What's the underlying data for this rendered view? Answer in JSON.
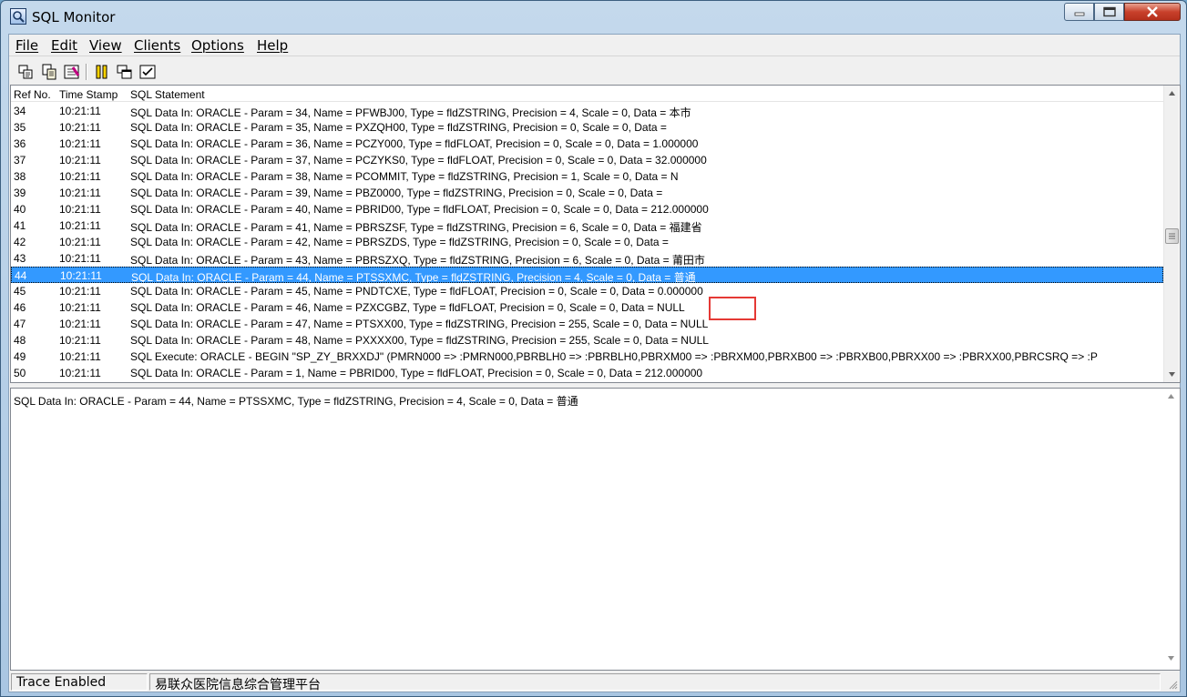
{
  "window": {
    "title": "SQL Monitor"
  },
  "menu": [
    "File",
    "Edit",
    "View",
    "Clients",
    "Options",
    "Help"
  ],
  "toolbar": {
    "buttons": [
      "save-log-icon",
      "copy-icon",
      "clear-icon",
      "pause-icon",
      "client-window-icon",
      "checklist-icon"
    ]
  },
  "columns": {
    "ref": "Ref No.",
    "time": "Time Stamp",
    "stmt": "SQL Statement"
  },
  "rows": [
    {
      "ref": "34",
      "time": "10:21:11",
      "stmt": "SQL Data In: ORACLE - Param = 34, Name = PFWBJ00, Type = fldZSTRING, Precision = 4, Scale = 0, Data = 本市"
    },
    {
      "ref": "35",
      "time": "10:21:11",
      "stmt": "SQL Data In: ORACLE - Param = 35, Name = PXZQH00, Type = fldZSTRING, Precision = 0, Scale = 0, Data ="
    },
    {
      "ref": "36",
      "time": "10:21:11",
      "stmt": "SQL Data In: ORACLE - Param = 36, Name = PCZY000, Type = fldFLOAT, Precision = 0, Scale = 0, Data = 1.000000"
    },
    {
      "ref": "37",
      "time": "10:21:11",
      "stmt": "SQL Data In: ORACLE - Param = 37, Name = PCZYKS0, Type = fldFLOAT, Precision = 0, Scale = 0, Data = 32.000000"
    },
    {
      "ref": "38",
      "time": "10:21:11",
      "stmt": "SQL Data In: ORACLE - Param = 38, Name = PCOMMIT, Type = fldZSTRING, Precision = 1, Scale = 0, Data = N"
    },
    {
      "ref": "39",
      "time": "10:21:11",
      "stmt": "SQL Data In: ORACLE - Param = 39, Name = PBZ0000, Type = fldZSTRING, Precision = 0, Scale = 0, Data ="
    },
    {
      "ref": "40",
      "time": "10:21:11",
      "stmt": "SQL Data In: ORACLE - Param = 40, Name = PBRID00, Type = fldFLOAT, Precision = 0, Scale = 0, Data = 212.000000"
    },
    {
      "ref": "41",
      "time": "10:21:11",
      "stmt": "SQL Data In: ORACLE - Param = 41, Name = PBRSZSF, Type = fldZSTRING, Precision = 6, Scale = 0, Data = 福建省"
    },
    {
      "ref": "42",
      "time": "10:21:11",
      "stmt": "SQL Data In: ORACLE - Param = 42, Name = PBRSZDS, Type = fldZSTRING, Precision = 0, Scale = 0, Data ="
    },
    {
      "ref": "43",
      "time": "10:21:11",
      "stmt": "SQL Data In: ORACLE - Param = 43, Name = PBRSZXQ, Type = fldZSTRING, Precision = 6, Scale = 0, Data = 莆田市"
    },
    {
      "ref": "44",
      "time": "10:21:11",
      "stmt": "SQL Data In: ORACLE - Param = 44, Name = PTSSXMC, Type = fldZSTRING, Precision = 4, Scale = 0, Data = 普通",
      "selected": true
    },
    {
      "ref": "45",
      "time": "10:21:11",
      "stmt": "SQL Data In: ORACLE - Param = 45, Name = PNDTCXE, Type = fldFLOAT, Precision = 0, Scale = 0, Data = 0.000000"
    },
    {
      "ref": "46",
      "time": "10:21:11",
      "stmt": "SQL Data In: ORACLE - Param = 46, Name = PZXCGBZ, Type = fldFLOAT, Precision = 0, Scale = 0, Data = NULL"
    },
    {
      "ref": "47",
      "time": "10:21:11",
      "stmt": "SQL Data In: ORACLE - Param = 47, Name = PTSXX00, Type = fldZSTRING, Precision = 255, Scale = 0, Data = NULL"
    },
    {
      "ref": "48",
      "time": "10:21:11",
      "stmt": "SQL Data In: ORACLE - Param = 48, Name = PXXXX00, Type = fldZSTRING, Precision = 255, Scale = 0, Data = NULL"
    },
    {
      "ref": "49",
      "time": "10:21:11",
      "stmt": "SQL Execute: ORACLE - BEGIN \"SP_ZY_BRXXDJ\" (PMRN000 => :PMRN000,PBRBLH0 => :PBRBLH0,PBRXM00 => :PBRXM00,PBRXB00 => :PBRXB00,PBRXX00 => :PBRXX00,PBRCSRQ => :P"
    },
    {
      "ref": "50",
      "time": "10:21:11",
      "stmt": "SQL Data In: ORACLE - Param = 1, Name = PBRID00, Type = fldFLOAT, Precision = 0, Scale = 0, Data = 212.000000"
    }
  ],
  "detail": {
    "text": "SQL Data In: ORACLE - Param = 44, Name = PTSSXMC, Type = fldZSTRING, Precision = 4, Scale = 0, Data = 普通"
  },
  "status": {
    "trace": "Trace Enabled",
    "client": "易联众医院信息综合管理平台"
  }
}
